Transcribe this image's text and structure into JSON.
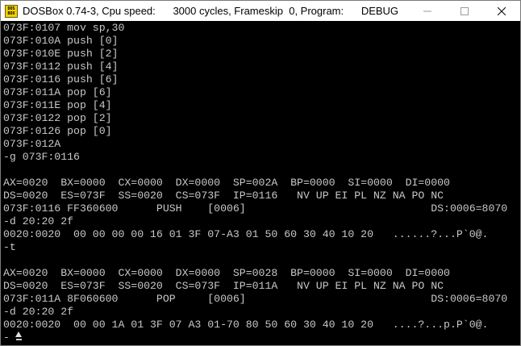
{
  "window": {
    "title_parts": [
      "DOSBox 0.74-3, Cpu speed:",
      "3000 cycles, Frameskip  0, Program:",
      "DEBUG"
    ],
    "icon_label_top": "DOS",
    "icon_label_bottom": "BOX",
    "minimize_icon": "minimize-icon",
    "maximize_icon": "maximize-icon",
    "close_icon": "close-icon"
  },
  "console": {
    "lines": [
      "073F:0107 mov sp,30",
      "073F:010A push [0]",
      "073F:010E push [2]",
      "073F:0112 push [4]",
      "073F:0116 push [6]",
      "073F:011A pop [6]",
      "073F:011E pop [4]",
      "073F:0122 pop [2]",
      "073F:0126 pop [0]",
      "073F:012A",
      "-g 073F:0116",
      "",
      "AX=0020  BX=0000  CX=0000  DX=0000  SP=002A  BP=0000  SI=0000  DI=0000",
      "DS=0020  ES=073F  SS=0020  CS=073F  IP=0116   NV UP EI PL NZ NA PO NC",
      "073F:0116 FF360600      PUSH    [0006]                             DS:0006=8070",
      "-d 20:20 2f",
      "0020:0020  00 00 00 00 16 01 3F 07-A3 01 50 60 30 40 10 20   ......?...P`0@.",
      "-t",
      "",
      "AX=0020  BX=0000  CX=0000  DX=0000  SP=0028  BP=0000  SI=0000  DI=0000",
      "DS=0020  ES=073F  SS=0020  CS=073F  IP=011A   NV UP EI PL NZ NA PO NC",
      "073F:011A 8F060600      POP     [0006]                             DS:0006=8070",
      "-d 20:20 2f",
      "0020:0020  00 00 1A 01 3F 07 A3 01-70 80 50 60 30 40 10 20   ....?...p.P`0@."
    ],
    "prompt": "-"
  }
}
